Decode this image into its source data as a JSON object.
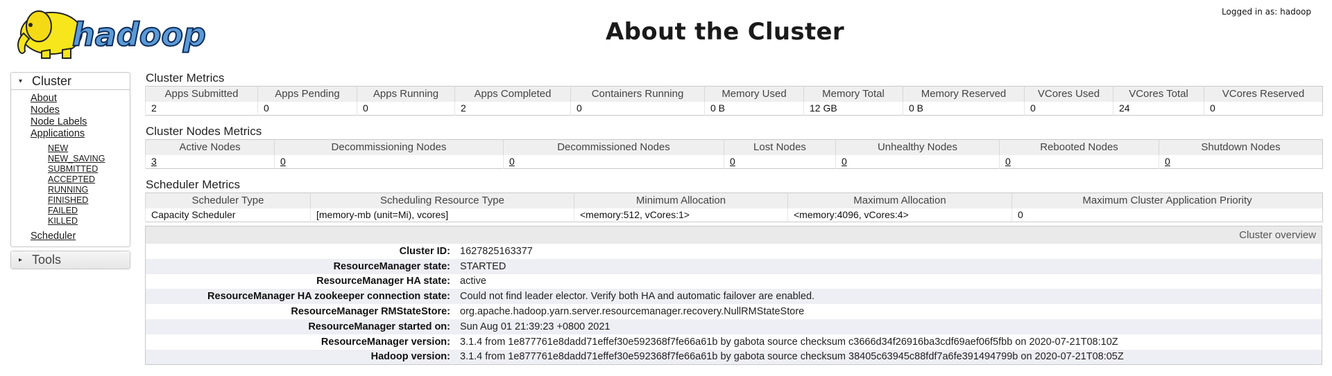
{
  "header": {
    "logo_text": "hadoop",
    "title": "About the Cluster",
    "logged_in": "Logged in as: hadoop"
  },
  "colors": {
    "logo_yellow": "#f7e61c",
    "logo_blue": "#1f5fa8",
    "header_gray": "#efefef",
    "row_alt": "#eeeef5"
  },
  "nav": {
    "cluster": {
      "label": "Cluster",
      "icon": "triangle-down-icon",
      "links": [
        "About",
        "Nodes",
        "Node Labels",
        "Applications"
      ],
      "app_states": [
        "NEW",
        "NEW_SAVING",
        "SUBMITTED",
        "ACCEPTED",
        "RUNNING",
        "FINISHED",
        "FAILED",
        "KILLED"
      ],
      "scheduler": "Scheduler"
    },
    "tools": {
      "label": "Tools",
      "icon": "triangle-right-icon"
    }
  },
  "cluster_metrics": {
    "title": "Cluster Metrics",
    "headers": [
      "Apps Submitted",
      "Apps Pending",
      "Apps Running",
      "Apps Completed",
      "Containers Running",
      "Memory Used",
      "Memory Total",
      "Memory Reserved",
      "VCores Used",
      "VCores Total",
      "VCores Reserved"
    ],
    "values": [
      "2",
      "0",
      "0",
      "2",
      "0",
      "0 B",
      "12 GB",
      "0 B",
      "0",
      "24",
      "0"
    ]
  },
  "node_metrics": {
    "title": "Cluster Nodes Metrics",
    "headers": [
      "Active Nodes",
      "Decommissioning Nodes",
      "Decommissioned Nodes",
      "Lost Nodes",
      "Unhealthy Nodes",
      "Rebooted Nodes",
      "Shutdown Nodes"
    ],
    "values": [
      "3",
      "0",
      "0",
      "0",
      "0",
      "0",
      "0"
    ]
  },
  "scheduler_metrics": {
    "title": "Scheduler Metrics",
    "headers": [
      "Scheduler Type",
      "Scheduling Resource Type",
      "Minimum Allocation",
      "Maximum Allocation",
      "Maximum Cluster Application Priority"
    ],
    "values": [
      "Capacity Scheduler",
      "[memory-mb (unit=Mi), vcores]",
      "<memory:512, vCores:1>",
      "<memory:4096, vCores:4>",
      "0"
    ]
  },
  "overview": {
    "title": "Cluster overview",
    "rows": [
      {
        "label": "Cluster ID:",
        "value": "1627825163377"
      },
      {
        "label": "ResourceManager state:",
        "value": "STARTED"
      },
      {
        "label": "ResourceManager HA state:",
        "value": "active"
      },
      {
        "label": "ResourceManager HA zookeeper connection state:",
        "value": "Could not find leader elector. Verify both HA and automatic failover are enabled."
      },
      {
        "label": "ResourceManager RMStateStore:",
        "value": "org.apache.hadoop.yarn.server.resourcemanager.recovery.NullRMStateStore"
      },
      {
        "label": "ResourceManager started on:",
        "value": "Sun Aug 01 21:39:23 +0800 2021"
      },
      {
        "label": "ResourceManager version:",
        "value": "3.1.4 from 1e877761e8dadd71effef30e592368f7fe66a61b by gabota source checksum c3666d34f26916ba3cdf69aef06f5fbb on 2020-07-21T08:10Z"
      },
      {
        "label": "Hadoop version:",
        "value": "3.1.4 from 1e877761e8dadd71effef30e592368f7fe66a61b by gabota source checksum 38405c63945c88fdf7a6fe391494799b on 2020-07-21T08:05Z"
      }
    ]
  }
}
